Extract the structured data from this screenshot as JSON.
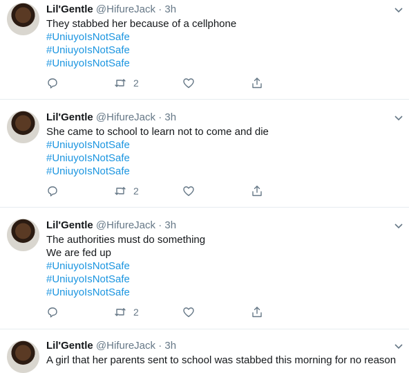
{
  "tweets": [
    {
      "name": "Lil'Gentle",
      "handle": "@HifureJack",
      "separator": "·",
      "time": "3h",
      "lines": [
        "They stabbed her because of a cellphone"
      ],
      "hashtags": [
        "#UniuyoIsNotSafe",
        "#UniuyoIsNotSafe",
        "#UniuyoIsNotSafe"
      ],
      "retweets": "2"
    },
    {
      "name": "Lil'Gentle",
      "handle": "@HifureJack",
      "separator": "·",
      "time": "3h",
      "lines": [
        "She came to school to learn not to come and die"
      ],
      "hashtags": [
        "#UniuyoIsNotSafe",
        "#UniuyoIsNotSafe",
        "#UniuyoIsNotSafe"
      ],
      "retweets": "2"
    },
    {
      "name": "Lil'Gentle",
      "handle": "@HifureJack",
      "separator": "·",
      "time": "3h",
      "lines": [
        "The authorities must do something",
        "We are fed up"
      ],
      "hashtags": [
        "#UniuyoIsNotSafe",
        "#UniuyoIsNotSafe",
        "#UniuyoIsNotSafe"
      ],
      "retweets": "2"
    },
    {
      "name": "Lil'Gentle",
      "handle": "@HifureJack",
      "separator": "·",
      "time": "3h",
      "lines": [
        "A girl that her parents sent to school was stabbed this morning for no reason"
      ],
      "hashtags": [],
      "retweets": ""
    }
  ],
  "icons": {
    "reply": "reply-icon",
    "retweet": "retweet-icon",
    "like": "like-icon",
    "share": "share-icon",
    "more": "chevron-down-icon"
  },
  "colors": {
    "hashtag": "#1b95e0",
    "muted": "#657786",
    "divider": "#e6ecf0"
  }
}
